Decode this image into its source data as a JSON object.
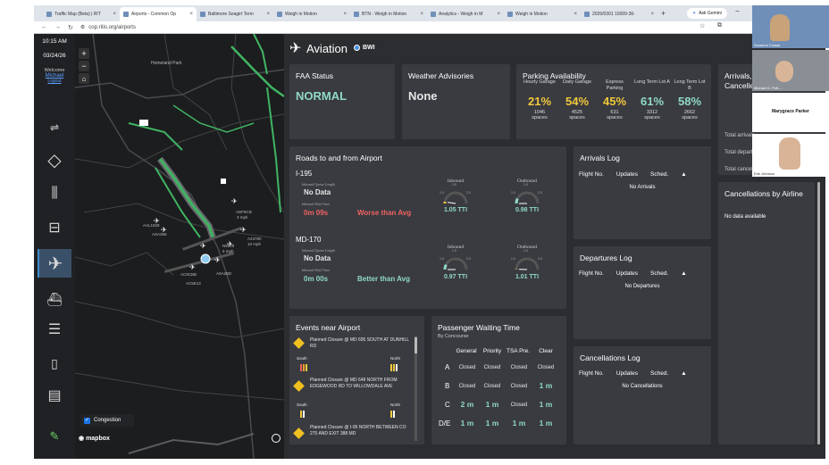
{
  "browser": {
    "tabs": [
      "Traffic Map (Beta) | RIT",
      "Airports - Common Op",
      "Baltimore Seagirt Term",
      "Weigh in Motion",
      "BTN - Weigh in Motion",
      "Analytics - Weigh in M",
      "Weigh in Motion",
      "2026/0301 10009-36-"
    ],
    "url": "cop.ritis.org/airports",
    "ask_gemini": "Ask Gemini"
  },
  "leftnav": {
    "time": "10:15 AM",
    "date": "03/24/26",
    "welcome": "Welcome",
    "user": "Michael",
    "logout": "Logout"
  },
  "map": {
    "place_label": "Homeland Park",
    "zoom_in": "+",
    "zoom_out": "−",
    "congestion_label": "Congestion",
    "mapbox": "mapbox",
    "aircraft": [
      {
        "id": "AAL1828",
        "speed": ""
      },
      {
        "id": "ASA356",
        "speed": ""
      },
      {
        "id": "ADF8CB",
        "speed": "3 mph"
      },
      {
        "id": "A23780",
        "speed": "10 mph"
      },
      {
        "id": "N8929",
        "speed": "5 mph"
      },
      {
        "id": "AC9CBB",
        "speed": ""
      },
      {
        "id": "A0A2BD",
        "speed": ""
      },
      {
        "id": "AC5E13",
        "speed": ""
      }
    ]
  },
  "header": {
    "title": "Aviation",
    "airport": "BWI"
  },
  "faa": {
    "title": "FAA Status",
    "value": "NORMAL"
  },
  "weather": {
    "title": "Weather Advisories",
    "value": "None"
  },
  "parking": {
    "title": "Parking Availability",
    "lots": [
      {
        "label": "Hourly Garage",
        "pct": "21%",
        "spaces": "1046",
        "unit": "spaces"
      },
      {
        "label": "Daily Garage",
        "pct": "54%",
        "spaces": "4525",
        "unit": "spaces"
      },
      {
        "label": "Express Parking",
        "pct": "45%",
        "spaces": "631",
        "unit": "spaces"
      },
      {
        "label": "Long Term Lot A",
        "pct": "61%",
        "spaces": "3312",
        "unit": "spaces"
      },
      {
        "label": "Long Term Lot B",
        "pct": "58%",
        "spaces": "2662",
        "unit": "spaces"
      }
    ]
  },
  "arrivals_summary": {
    "title": "Arrivals, Departures, Cancelled Flights",
    "rows": [
      "Total arrivals",
      "Total departures",
      "Total cancellations"
    ]
  },
  "roads": {
    "title": "Roads to and from Airport",
    "queue_label": "Inbound Queue Length",
    "wait_label": "Inbound Wait Time",
    "inbound": "Inbound",
    "outbound": "Outbound",
    "ticks": {
      "min": "1.0",
      "mid": "1.5",
      "max": "2.0"
    },
    "items": [
      {
        "name": "I-195",
        "queue": "No Data",
        "wait": "0m 09s",
        "compare": "Worse than Avg",
        "inbound_val": "1.05 TTI",
        "outbound_val": "0.98 TTI",
        "inbound_ratio": 1.05,
        "outbound_ratio": 0.98
      },
      {
        "name": "MD-170",
        "queue": "No Data",
        "wait": "0m 00s",
        "compare": "Better than Avg",
        "inbound_val": "0.97 TTI",
        "outbound_val": "1.01 TTI",
        "inbound_ratio": 0.97,
        "outbound_ratio": 1.01
      }
    ]
  },
  "arrivals_log": {
    "title": "Arrivals Log",
    "cols": [
      "Flight No.",
      "Updates",
      "Sched."
    ],
    "empty": "No Arrivals"
  },
  "departures_log": {
    "title": "Departures Log",
    "cols": [
      "Flight No.",
      "Updates",
      "Sched."
    ],
    "empty": "No Departures"
  },
  "cancellations_log": {
    "title": "Cancellations Log",
    "cols": [
      "Flight No.",
      "Updates",
      "Sched."
    ],
    "empty": "No Cancellations"
  },
  "cancellations_airline": {
    "title": "Cancellations by Airline",
    "empty": "No data available"
  },
  "events": {
    "title": "Events near Airport",
    "south": "South",
    "north": "North",
    "items": [
      "Planned Closure @ MD 695 SOUTH AT DUNHILL RD",
      "Planned Closure @ MD 648 NORTH FROM EDGEWOOD RD TO WILLOWDALE AVE",
      "Planned Closure @ I-95 NORTH BETWEEN CO 275 AND EXIT 388 MD"
    ]
  },
  "passenger_wait": {
    "title": "Passenger Waiting Time",
    "subtitle": "By Concourse",
    "cols": [
      "General",
      "Priority",
      "TSA Pre.",
      "Clear"
    ],
    "rows": [
      {
        "concourse": "A",
        "values": [
          "Closed",
          "Closed",
          "Closed",
          "Closed"
        ]
      },
      {
        "concourse": "B",
        "values": [
          "Closed",
          "Closed",
          "Closed",
          "1 m"
        ]
      },
      {
        "concourse": "C",
        "values": [
          "2 m",
          "1 m",
          "Closed",
          "1 m"
        ]
      },
      {
        "concourse": "D/E",
        "values": [
          "1 m",
          "1 m",
          "1 m",
          "1 m"
        ]
      }
    ]
  },
  "video": {
    "participants": [
      "Suzanne Cossar",
      "Michael G. Pott...",
      "Marygrace Parker",
      "Erik Johnson"
    ]
  }
}
